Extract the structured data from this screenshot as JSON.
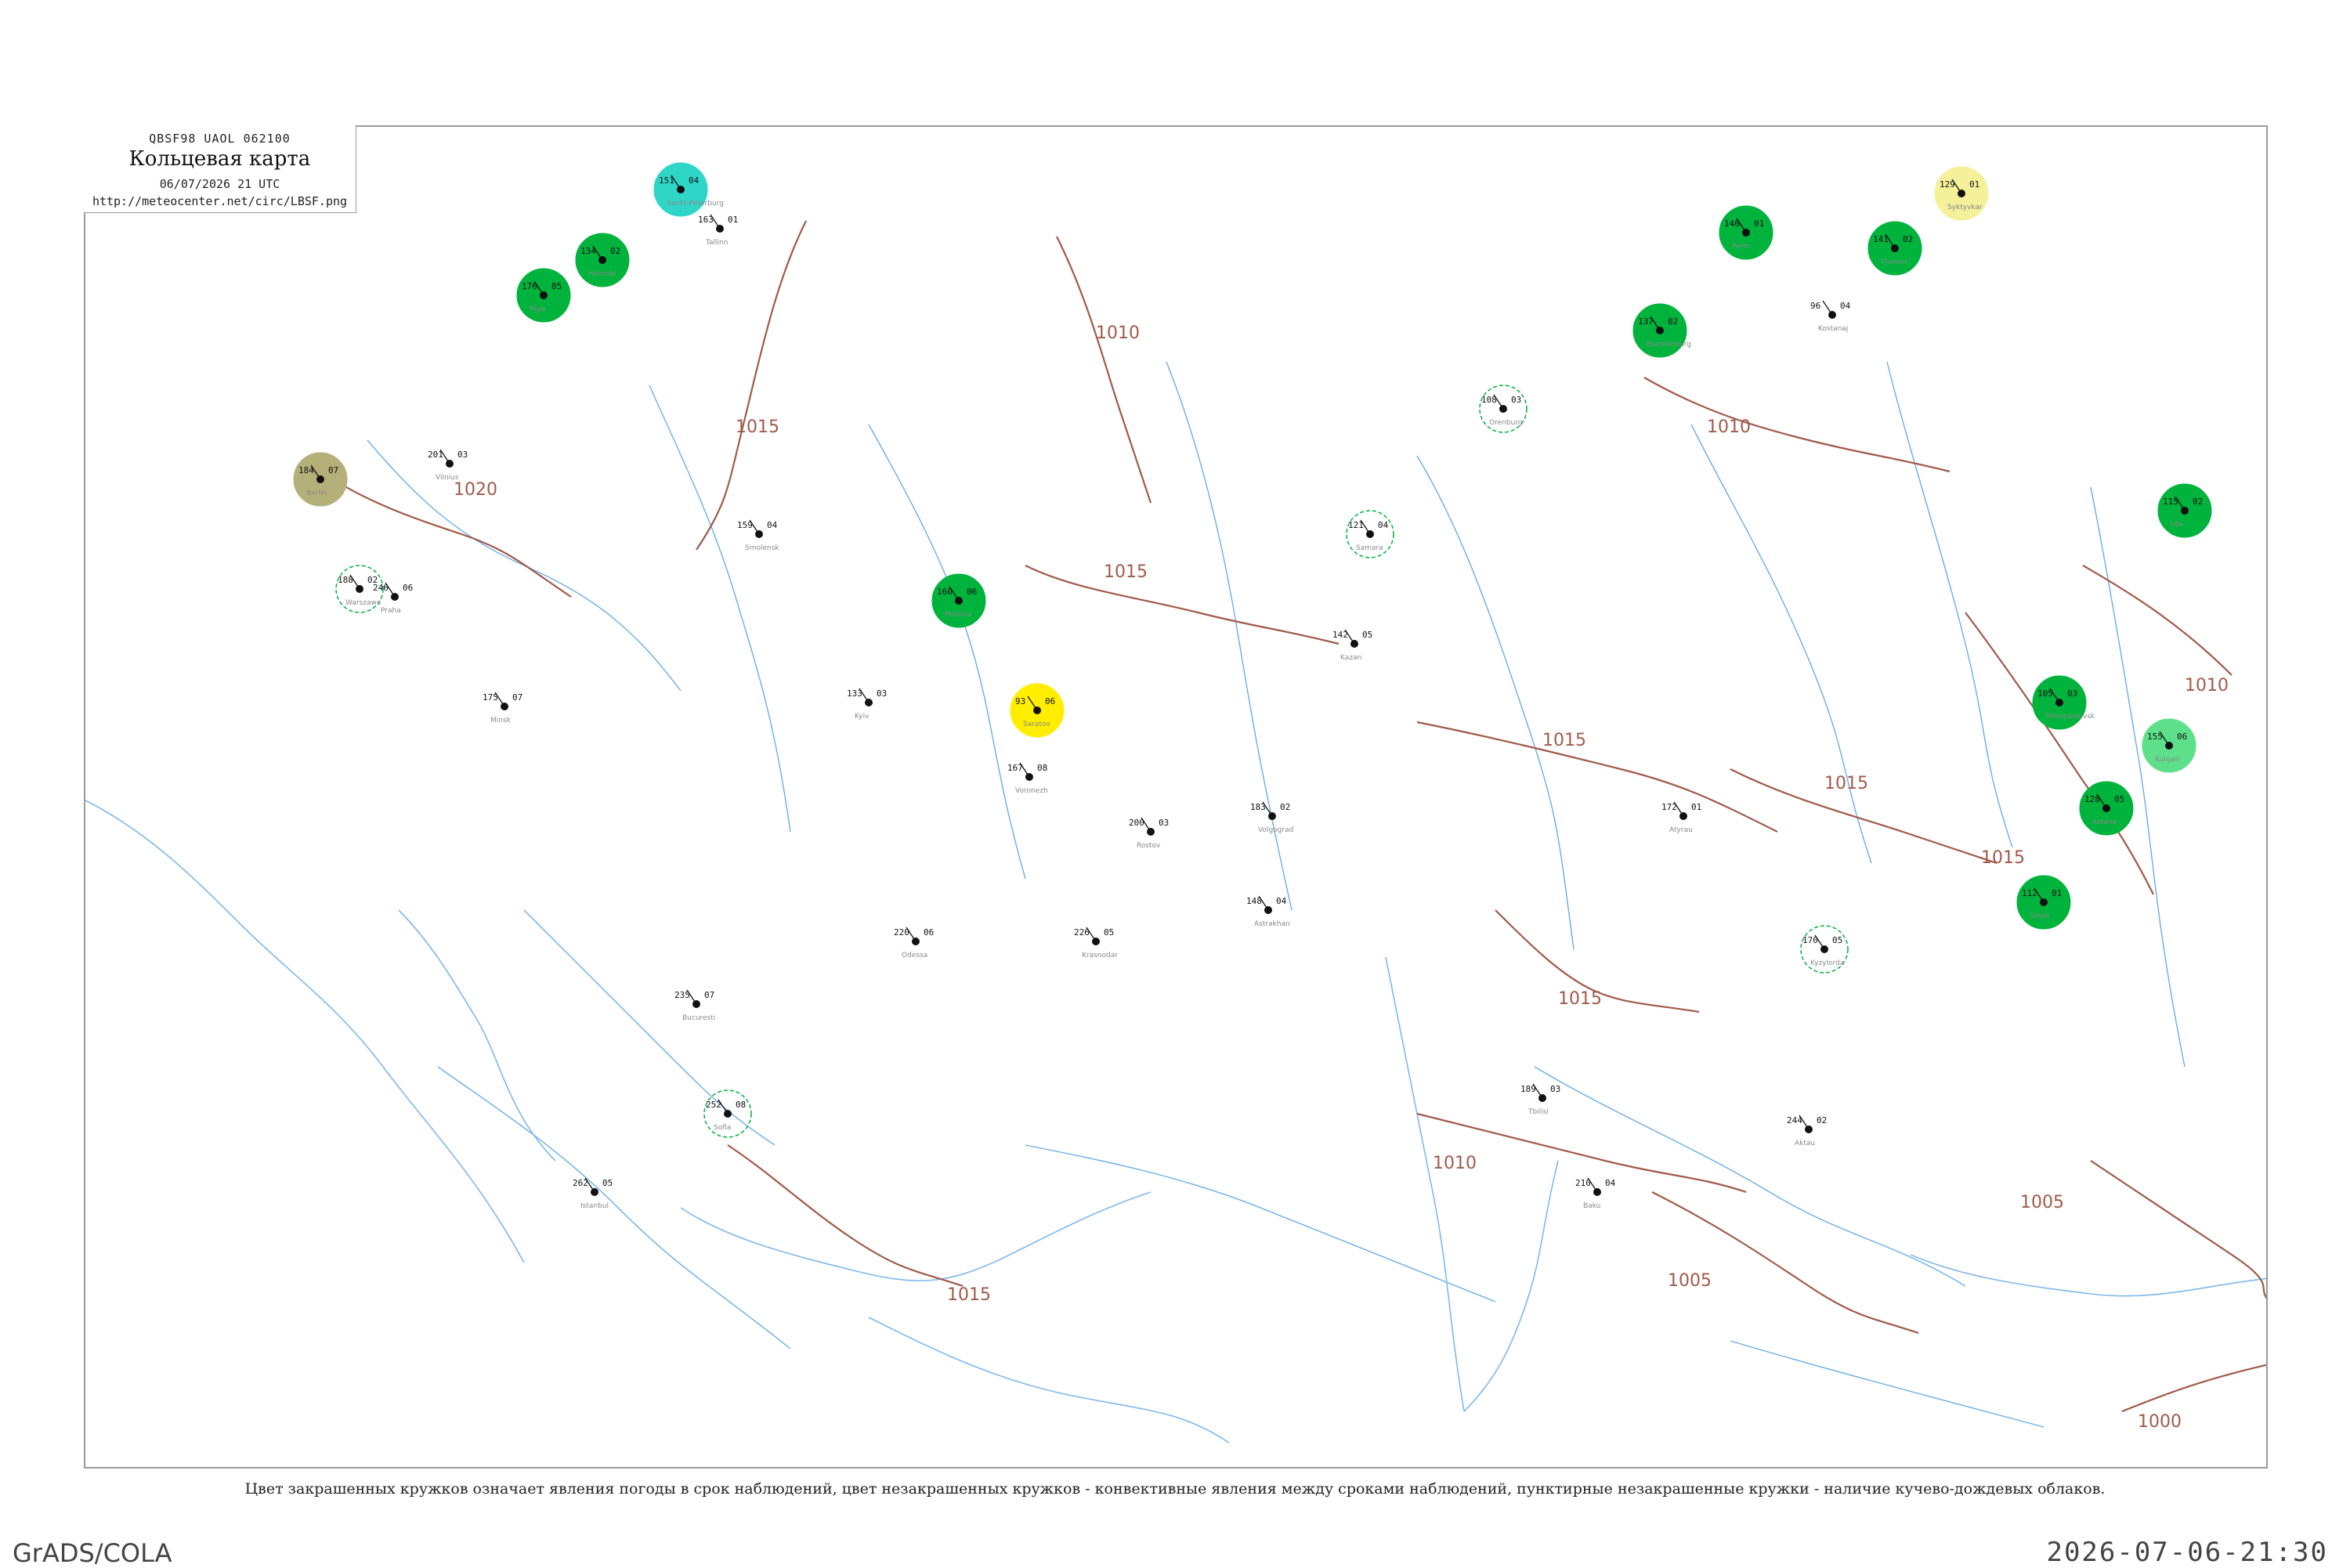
{
  "header": {
    "code_line": "QBSF98  UAOL  062100",
    "title": "Кольцевая карта",
    "date_line": "06/07/2026 21 UTC",
    "url": "http://meteocenter.net/circ/LBSF.png"
  },
  "legend_caption": "Цвет закрашенных кружков означает явления погоды в срок наблюдений, цвет незакрашенных кружков - конвективные явления между сроками наблюдений, пунктирные незакрашенные кружки - наличие кучево-дождевых облаков.",
  "footer": {
    "software": "GrADS/COLA",
    "timestamp": "2026-07-06-21:30"
  },
  "colors": {
    "isobar": "#a05a4a",
    "water": "#6aaee8",
    "rain": "#00b33c",
    "drizzle": "#2fd6c8",
    "fog": "#f5f19a",
    "thunder_yellow": "#ffee00",
    "haze": "#b5b07a",
    "dust_outline": "#d94a7a",
    "light_rain": "#5ee08a"
  },
  "isobars": [
    {
      "label": "1015"
    },
    {
      "label": "1020"
    },
    {
      "label": "1010"
    },
    {
      "label": "1015"
    },
    {
      "label": "1015"
    },
    {
      "label": "1015"
    },
    {
      "label": "1010"
    },
    {
      "label": "1010"
    },
    {
      "label": "1010"
    },
    {
      "label": "1015"
    },
    {
      "label": "1015"
    },
    {
      "label": "1005"
    },
    {
      "label": "1005"
    },
    {
      "label": "1000"
    },
    {
      "label": "1015"
    }
  ],
  "stations": [
    {
      "t": "160",
      "p": "06",
      "n": "Moskva",
      "c": "rain"
    },
    {
      "t": "142",
      "p": "05",
      "n": "Kazan",
      "c": ""
    },
    {
      "t": "175",
      "p": "07",
      "n": "Minsk",
      "c": ""
    },
    {
      "t": "188",
      "p": "02",
      "n": "Warszawa",
      "c": ""
    },
    {
      "t": "133",
      "p": "03",
      "n": "Kyiv",
      "c": ""
    },
    {
      "t": "151",
      "p": "04",
      "n": "Sankt-Peterburg",
      "c": "drizzle"
    },
    {
      "t": "129",
      "p": "01",
      "n": "Syktyvkar",
      "c": "fog"
    },
    {
      "t": "115",
      "p": "02",
      "n": "Ufa",
      "c": "rain"
    },
    {
      "t": "93",
      "p": "06",
      "n": "Saratov",
      "c": "thunder"
    },
    {
      "t": "121",
      "p": "04",
      "n": "Samara",
      "c": ""
    },
    {
      "t": "167",
      "p": "08",
      "n": "Voronezh",
      "c": ""
    },
    {
      "t": "200",
      "p": "03",
      "n": "Rostov",
      "c": ""
    },
    {
      "t": "226",
      "p": "05",
      "n": "Krasnodar",
      "c": ""
    },
    {
      "t": "146",
      "p": "01",
      "n": "Perm",
      "c": "rain"
    },
    {
      "t": "137",
      "p": "02",
      "n": "Ekaterinburg",
      "c": "rain"
    },
    {
      "t": "108",
      "p": "03",
      "n": "Orenburg",
      "c": ""
    },
    {
      "t": "96",
      "p": "04",
      "n": "Kostanaj",
      "c": ""
    },
    {
      "t": "184",
      "p": "07",
      "n": "Berlin",
      "c": "haze"
    },
    {
      "t": "246",
      "p": "06",
      "n": "Praha",
      "c": ""
    },
    {
      "t": "201",
      "p": "03",
      "n": "Vilnius",
      "c": ""
    },
    {
      "t": "176",
      "p": "05",
      "n": "Riga",
      "c": "rain"
    },
    {
      "t": "134",
      "p": "02",
      "n": "Helsinki",
      "c": "rain"
    },
    {
      "t": "163",
      "p": "01",
      "n": "Tallinn",
      "c": ""
    },
    {
      "t": "159",
      "p": "04",
      "n": "Smolensk",
      "c": ""
    },
    {
      "t": "141",
      "p": "02",
      "n": "Tjumen",
      "c": "rain"
    },
    {
      "t": "155",
      "p": "06",
      "n": "Kurgan",
      "c": "light_rain"
    },
    {
      "t": "112",
      "p": "01",
      "n": "Omsk",
      "c": "rain"
    },
    {
      "t": "105",
      "p": "03",
      "n": "Petropavlovsk",
      "c": "rain"
    },
    {
      "t": "128",
      "p": "05",
      "n": "Astana",
      "c": "rain"
    },
    {
      "t": "148",
      "p": "04",
      "n": "Astrakhan",
      "c": ""
    },
    {
      "t": "183",
      "p": "02",
      "n": "Volgograd",
      "c": ""
    },
    {
      "t": "220",
      "p": "06",
      "n": "Odessa",
      "c": ""
    },
    {
      "t": "235",
      "p": "07",
      "n": "Bucuresti",
      "c": ""
    },
    {
      "t": "252",
      "p": "08",
      "n": "Sofia",
      "c": ""
    },
    {
      "t": "262",
      "p": "05",
      "n": "Istanbul",
      "c": ""
    },
    {
      "t": "189",
      "p": "03",
      "n": "Tbilisi",
      "c": ""
    },
    {
      "t": "210",
      "p": "04",
      "n": "Baku",
      "c": ""
    },
    {
      "t": "244",
      "p": "02",
      "n": "Aktau",
      "c": ""
    },
    {
      "t": "172",
      "p": "01",
      "n": "Atyrau",
      "c": ""
    },
    {
      "t": "170",
      "p": "05",
      "n": "Kyzylorda",
      "c": ""
    }
  ]
}
